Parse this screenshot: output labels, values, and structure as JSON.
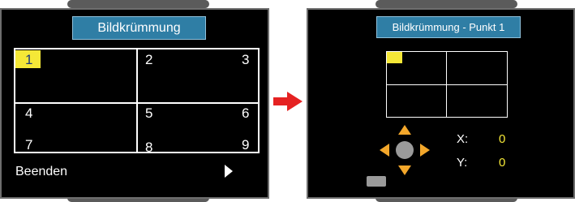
{
  "left_menu": {
    "title": "Bildkrümmung",
    "cells": [
      "1",
      "2",
      "3",
      "4",
      "5",
      "6",
      "7",
      "8",
      "9"
    ],
    "selected_cell": "1",
    "exit_label": "Beenden"
  },
  "right_menu": {
    "title": "Bildkrümmung - Punkt 1",
    "x_label": "X:",
    "x_value": "0",
    "y_label": "Y:",
    "y_value": "0"
  },
  "colors": {
    "title_bg": "#2f7ea5",
    "highlight": "#f5e837",
    "arrow": "#f3a72b",
    "arrow_red": "#e52222"
  },
  "icons": [
    "arrow-right-red-icon",
    "play-right-icon",
    "dpad-icon",
    "small-button-icon"
  ]
}
